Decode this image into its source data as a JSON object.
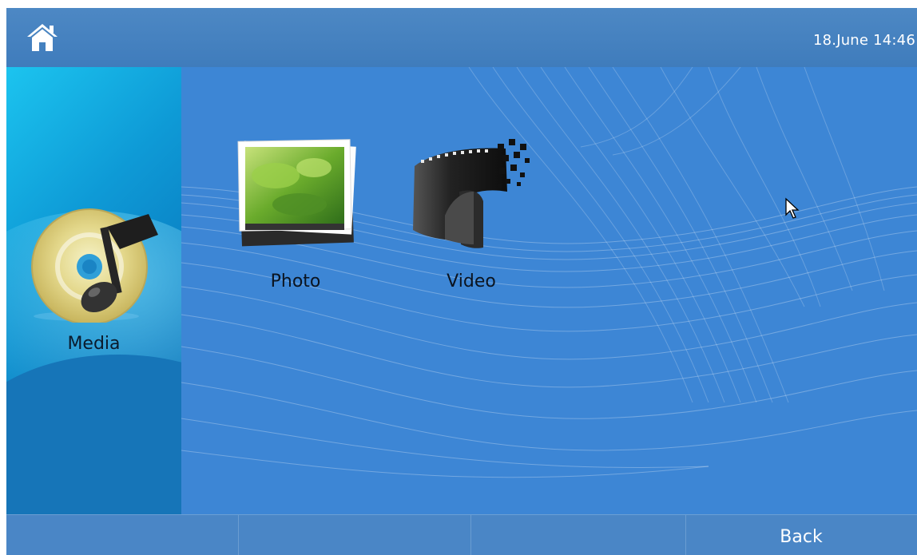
{
  "header": {
    "home_icon": "home-icon",
    "datetime": "18.June 14:46"
  },
  "sidebar": {
    "section_icon": "music-disc-icon",
    "section_label": "Media"
  },
  "main": {
    "tiles": [
      {
        "icon": "photo-stack-icon",
        "label": "Photo"
      },
      {
        "icon": "film-reel-icon",
        "label": "Video"
      }
    ]
  },
  "footer": {
    "back_label": "Back"
  },
  "colors": {
    "background": "#3d86d5",
    "topbar": "#4482c1",
    "sidepanel_accent": "#1cc4ef",
    "text_light": "#ffffff",
    "text_dark": "#0b1420"
  }
}
